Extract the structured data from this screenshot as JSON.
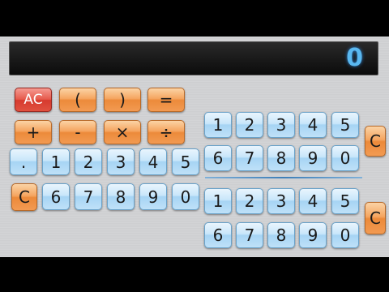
{
  "display": {
    "value": "0"
  },
  "left": {
    "ops_row1": [
      "AC",
      "(",
      ")",
      "="
    ],
    "ops_row2": [
      "+",
      "-",
      "×",
      "÷"
    ],
    "digits_row1": [
      ".",
      "1",
      "2",
      "3",
      "4",
      "5"
    ],
    "clear": "C",
    "digits_row2": [
      "6",
      "7",
      "8",
      "9",
      "0"
    ]
  },
  "top_right": {
    "digits_row1": [
      "1",
      "2",
      "3",
      "4",
      "5"
    ],
    "digits_row2": [
      "6",
      "7",
      "8",
      "9",
      "0"
    ],
    "clear": "C"
  },
  "bottom_right": {
    "digits_row1": [
      "1",
      "2",
      "3",
      "4",
      "5"
    ],
    "digits_row2": [
      "6",
      "7",
      "8",
      "9",
      "0"
    ],
    "clear": "C"
  }
}
